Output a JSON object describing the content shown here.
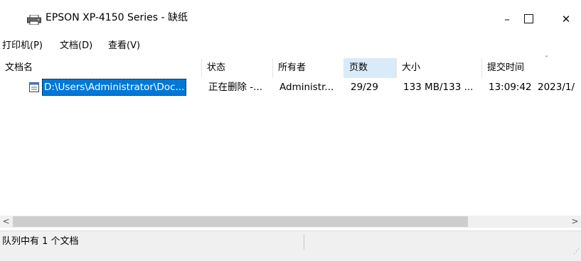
{
  "window": {
    "title": "EPSON XP-4150 Series - 缺纸",
    "minimize": "–",
    "close": "✕"
  },
  "menu": [
    {
      "label": "打印机(P)"
    },
    {
      "label": "文档(D)"
    },
    {
      "label": "查看(V)"
    }
  ],
  "columns": [
    {
      "label": "文档名"
    },
    {
      "label": "状态"
    },
    {
      "label": "所有者"
    },
    {
      "label": "页数"
    },
    {
      "label": "大小"
    },
    {
      "label": "提交时间"
    }
  ],
  "jobs": [
    {
      "name": "D:\\Users\\Administrator\\Doc...",
      "status": "正在删除 -...",
      "owner": "Administr...",
      "pages": "29/29",
      "size": "133 MB/133 ...",
      "time": "13:09:42",
      "date": "2023/1/"
    }
  ],
  "scroll": {
    "left": "<",
    "right": ">"
  },
  "status": {
    "text": "队列中有 1 个文档"
  },
  "colors": {
    "selection": "#0078d7",
    "sorted_header": "#d9ebf9",
    "statusbar": "#f0f0f0"
  },
  "icons": {
    "app": "printer-icon",
    "document": "document-icon"
  }
}
